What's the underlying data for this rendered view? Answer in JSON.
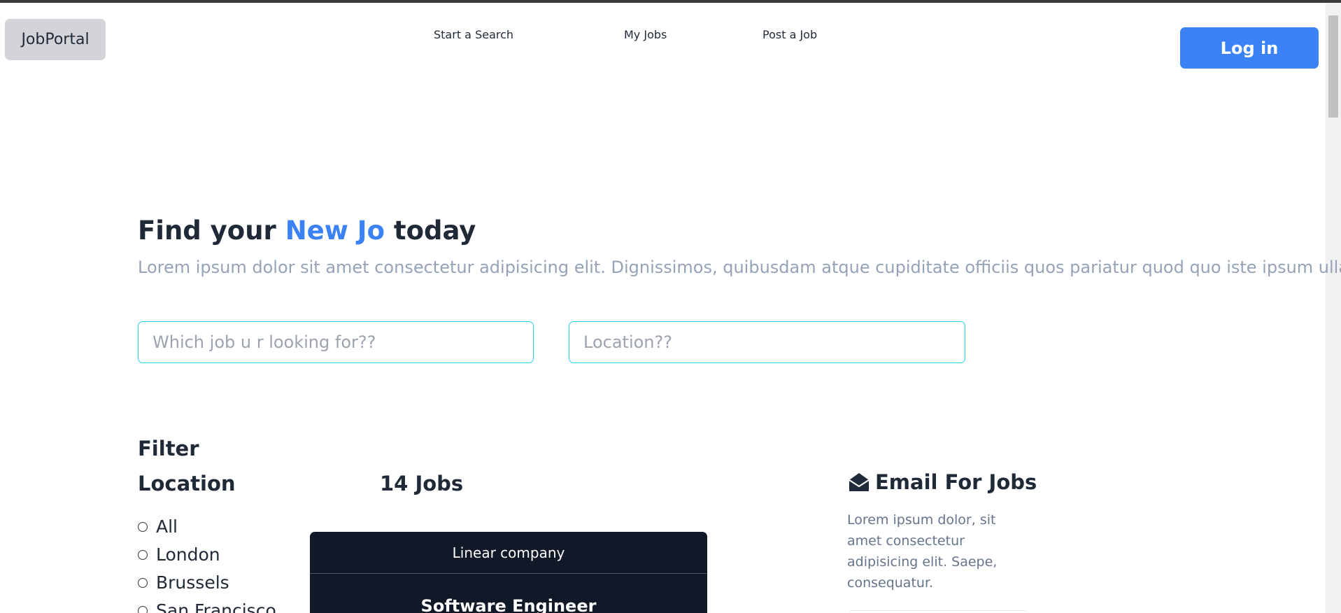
{
  "brand": "JobPortal",
  "nav": {
    "items": [
      {
        "label": "Start a Search"
      },
      {
        "label": "My Jobs"
      },
      {
        "label": "Post a Job"
      }
    ],
    "login_label": "Log in"
  },
  "hero": {
    "title_prefix": "Find your ",
    "title_accent": "New Jo",
    "title_suffix": " today",
    "subtitle": "Lorem ipsum dolor sit amet consectetur adipisicing elit. Dignissimos, quibusdam atque cupiditate officiis quos pariatur quod quo iste ipsum ullam?"
  },
  "search": {
    "job_placeholder": "Which job u r looking for??",
    "location_placeholder": "Location??"
  },
  "filter": {
    "title": "Filter",
    "location_title": "Location",
    "options": [
      "All",
      "London",
      "Brussels",
      "San Francisco"
    ]
  },
  "results": {
    "count_label": "14 Jobs"
  },
  "job_card": {
    "company": "Linear company",
    "title": "Software Engineer"
  },
  "email_box": {
    "title": "Email For Jobs",
    "text": "Lorem ipsum dolor, sit amet consectetur adipisicing elit. Saepe, consequatur."
  },
  "colors": {
    "accent": "#3b82f6",
    "input_border": "#22d3ee",
    "card_bg": "#111827"
  }
}
